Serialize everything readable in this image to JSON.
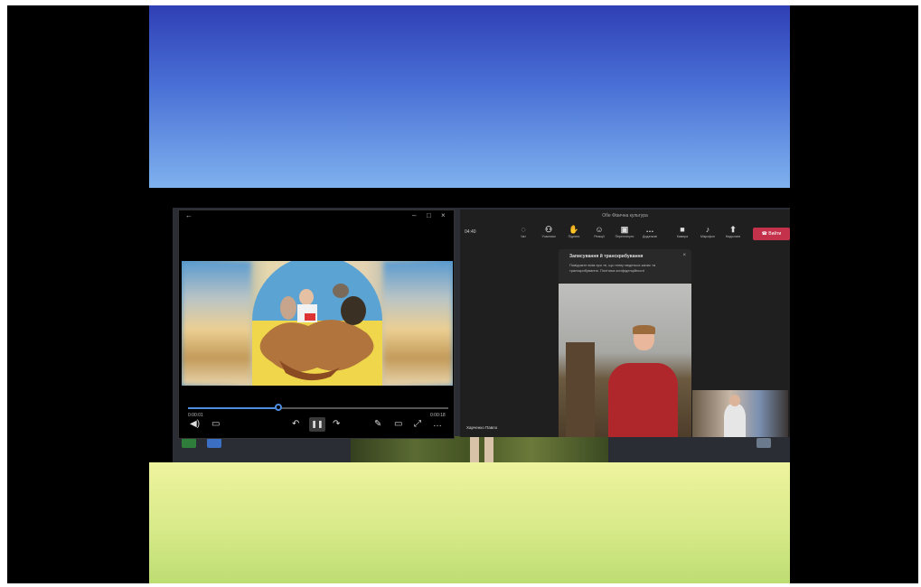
{
  "player": {
    "back_icon": "back-arrow-icon",
    "elapsed": "0:00:01",
    "total": "0:00:18",
    "progress_fraction": 0.34,
    "buttons": [
      "volume-icon",
      "subtitles-icon",
      "skip-back-icon",
      "pause-icon",
      "skip-forward-icon",
      "edit-icon",
      "cast-icon",
      "fullscreen-icon",
      "more-icon"
    ]
  },
  "teams": {
    "title": "Обе Фізична культура",
    "timer": "04:40",
    "toolbar": [
      {
        "icon": "chat-icon",
        "label": "Чат"
      },
      {
        "icon": "participants-icon",
        "label": "Учасники"
      },
      {
        "icon": "raise-hand-icon",
        "label": "Підняти"
      },
      {
        "icon": "reactions-icon",
        "label": "Реакції"
      },
      {
        "icon": "rooms-icon",
        "label": "Переглянути"
      },
      {
        "icon": "more-icon",
        "label": "Додаткові"
      },
      {
        "icon": "camera-icon",
        "label": "Камера"
      },
      {
        "icon": "mic-icon",
        "label": "Мікрофон"
      },
      {
        "icon": "share-icon",
        "label": "Надіслати"
      }
    ],
    "leave_label": "Вийти",
    "notice": {
      "heading": "Записування й транскрибування",
      "body": "Повідомте всім про те, що тепер ведеться запис та транскрибування. Політика конфіденційності",
      "close": "×"
    },
    "participant_name": "Харченко Павло"
  },
  "colors": {
    "accent_blue": "#4d8de0",
    "leave_red": "#c4314b",
    "top_band": "#3a55c8",
    "bottom_band": "#d8ea8a"
  }
}
